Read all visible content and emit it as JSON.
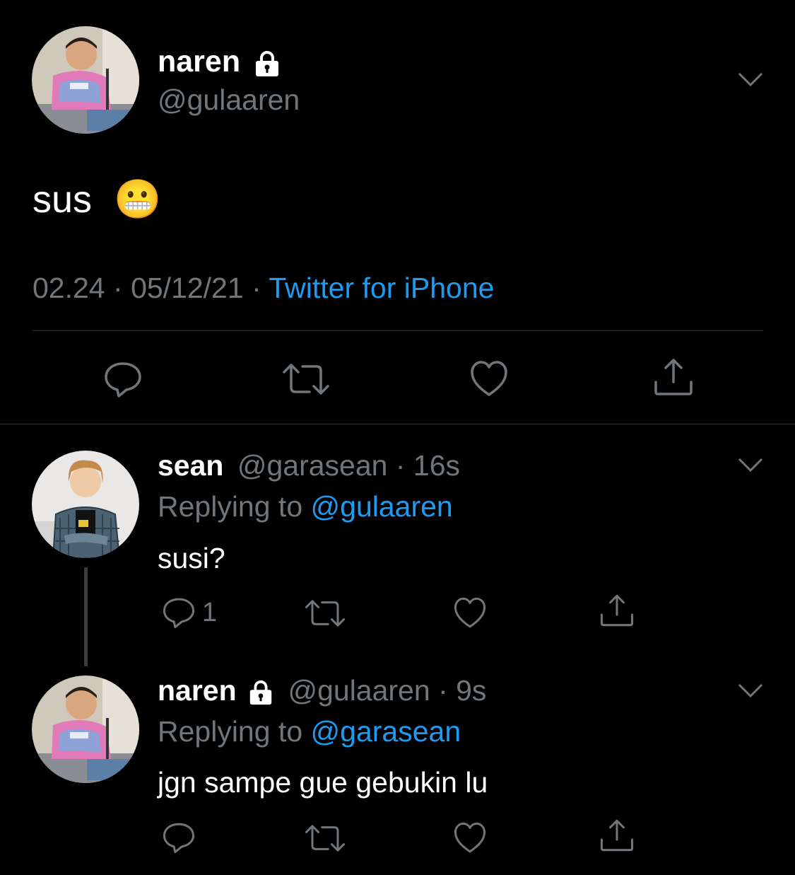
{
  "main_tweet": {
    "display_name": "naren",
    "handle": "@gulaaren",
    "text": "sus",
    "emoji": "😬",
    "time": "02.24",
    "date": "05/12/21",
    "source": "Twitter for iPhone"
  },
  "replies": [
    {
      "display_name": "sean",
      "handle": "@garasean",
      "time_ago": "16s",
      "replying_label": "Replying to",
      "replying_to": "@gulaaren",
      "text": "susi?",
      "reply_count": "1"
    },
    {
      "display_name": "naren",
      "handle": "@gulaaren",
      "time_ago": "9s",
      "replying_label": "Replying to",
      "replying_to": "@garasean",
      "text": "jgn sampe gue gebukin lu",
      "reply_count": ""
    }
  ],
  "colors": {
    "background": "#000000",
    "muted_text": "#71767b",
    "link": "#1d9bf0",
    "divider": "#2f3336"
  },
  "icons": [
    "lock-icon",
    "chevron-down-icon",
    "reply-icon",
    "retweet-icon",
    "like-icon",
    "share-icon"
  ]
}
